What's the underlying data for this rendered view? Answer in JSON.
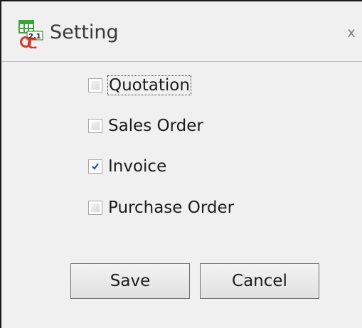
{
  "window": {
    "title": "Setting",
    "close_glyph": "x",
    "icon": "app-calc-icon"
  },
  "options": [
    {
      "label": "Quotation",
      "checked": false,
      "focused": true
    },
    {
      "label": "Sales Order",
      "checked": false,
      "focused": false
    },
    {
      "label": "Invoice",
      "checked": true,
      "focused": false
    },
    {
      "label": "Purchase Order",
      "checked": false,
      "focused": false
    }
  ],
  "buttons": {
    "save_label": "Save",
    "cancel_label": "Cancel"
  },
  "colors": {
    "window_bg": "#f0f0f0",
    "check_color": "#1f4e8c",
    "icon_green": "#3aa63a",
    "icon_red": "#d33a2a"
  }
}
